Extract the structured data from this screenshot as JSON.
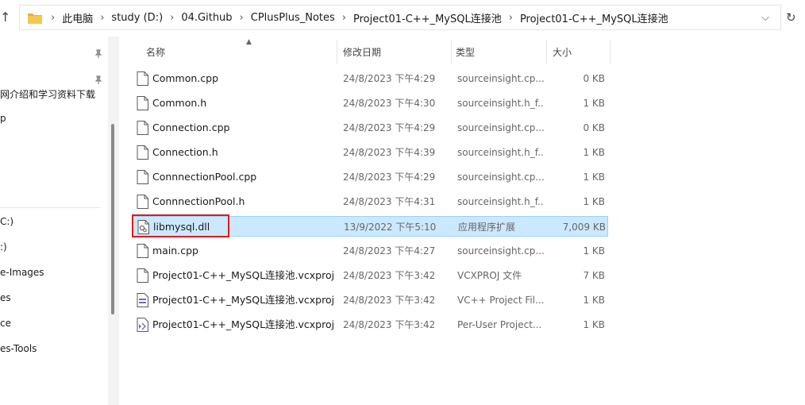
{
  "address": {
    "crumbs": [
      "此电脑",
      "study (D:)",
      "04.Github",
      "CPlusPlus_Notes",
      "Project01-C++_MySQL连接池",
      "Project01-C++_MySQL连接池"
    ],
    "up_arrow": "↑",
    "dropdown": "⌵",
    "refresh": "↻"
  },
  "nav": {
    "items": [
      "网介绍和学习资料下载",
      "p",
      "C:)",
      ":)",
      "e-Images",
      "es",
      "ce",
      "es-Tools"
    ]
  },
  "columns": {
    "name": "名称",
    "date": "修改日期",
    "type": "类型",
    "size": "大小"
  },
  "files": [
    {
      "name": "Common.cpp",
      "date": "24/8/2023 下午4:29",
      "type": "sourceinsight.cp...",
      "size": "0 KB",
      "icon": "file-icon"
    },
    {
      "name": "Common.h",
      "date": "24/8/2023 下午4:30",
      "type": "sourceinsight.h_f...",
      "size": "1 KB",
      "icon": "file-icon"
    },
    {
      "name": "Connection.cpp",
      "date": "24/8/2023 下午4:29",
      "type": "sourceinsight.cp...",
      "size": "0 KB",
      "icon": "file-icon"
    },
    {
      "name": "Connection.h",
      "date": "24/8/2023 下午4:39",
      "type": "sourceinsight.h_f...",
      "size": "1 KB",
      "icon": "file-icon"
    },
    {
      "name": "ConnnectionPool.cpp",
      "date": "24/8/2023 下午4:29",
      "type": "sourceinsight.cp...",
      "size": "1 KB",
      "icon": "file-icon"
    },
    {
      "name": "ConnnectionPool.h",
      "date": "24/8/2023 下午4:31",
      "type": "sourceinsight.h_f...",
      "size": "1 KB",
      "icon": "file-icon"
    },
    {
      "name": "libmysql.dll",
      "date": "13/9/2022 下午5:10",
      "type": "应用程序扩展",
      "size": "7,009 KB",
      "icon": "dll-icon"
    },
    {
      "name": "main.cpp",
      "date": "24/8/2023 下午4:27",
      "type": "sourceinsight.cp...",
      "size": "1 KB",
      "icon": "file-icon"
    },
    {
      "name": "Project01-C++_MySQL连接池.vcxproj",
      "date": "24/8/2023 下午3:42",
      "type": "VCXPROJ 文件",
      "size": "7 KB",
      "icon": "file-icon"
    },
    {
      "name": "Project01-C++_MySQL连接池.vcxproj....",
      "date": "24/8/2023 下午3:42",
      "type": "VC++ Project Fil...",
      "size": "1 KB",
      "icon": "vcxproj-filters-icon"
    },
    {
      "name": "Project01-C++_MySQL连接池.vcxproj....",
      "date": "24/8/2023 下午3:42",
      "type": "Per-User Project...",
      "size": "1 KB",
      "icon": "vcxproj-user-icon"
    }
  ],
  "selected_file": "libmysql.dll",
  "colors": {
    "selection_bg": "#cce8ff",
    "selection_border": "#99d1ff",
    "highlight_box": "#e0191f",
    "folder": "#f0c040"
  }
}
